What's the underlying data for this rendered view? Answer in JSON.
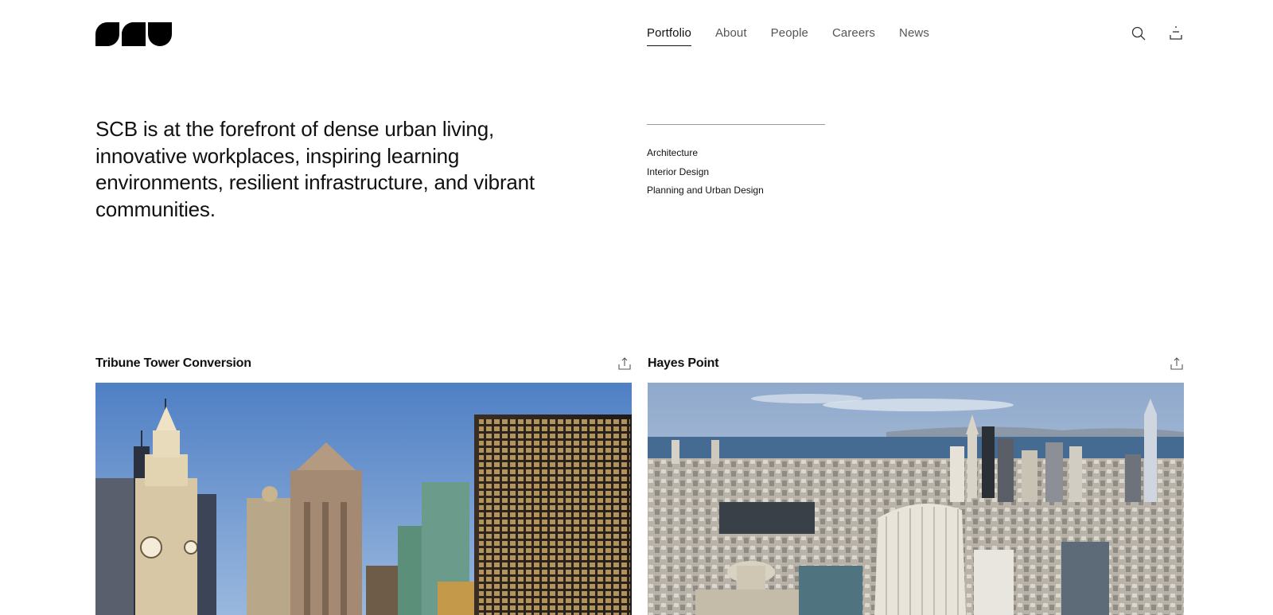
{
  "brand": {
    "logo_icon": "scb-logo-icon"
  },
  "nav": {
    "items": [
      {
        "label": "Portfolio",
        "active": true
      },
      {
        "label": "About",
        "active": false
      },
      {
        "label": "People",
        "active": false
      },
      {
        "label": "Careers",
        "active": false
      },
      {
        "label": "News",
        "active": false
      }
    ],
    "search_icon": "search-icon",
    "account_icon": "user-icon"
  },
  "intro": {
    "text": "SCB is at the forefront of dense urban living, innovative workplaces, inspiring learning environments, resilient infrastructure, and vibrant communities."
  },
  "disciplines": [
    "Architecture",
    "Interior Design",
    "Planning and Urban Design"
  ],
  "projects": [
    {
      "title": "Tribune Tower Conversion",
      "share_icon": "share-icon",
      "image": "chicago-skyline-photo"
    },
    {
      "title": "Hayes Point",
      "share_icon": "share-icon",
      "image": "san-francisco-aerial-photo"
    }
  ],
  "colors": {
    "text": "#111111",
    "nav_inactive": "#555555",
    "divider": "#9a9a9a",
    "background": "#ffffff"
  }
}
